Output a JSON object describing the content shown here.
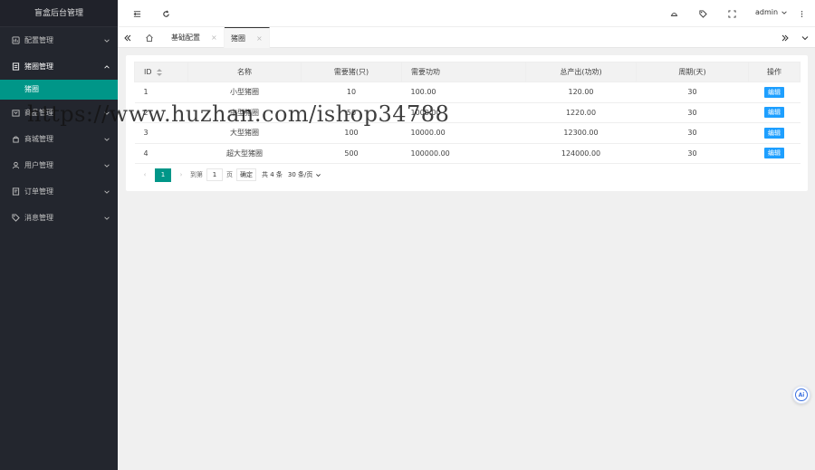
{
  "app": {
    "title": "盲盒后台管理"
  },
  "sidebar": {
    "items": [
      {
        "label": "配置管理",
        "icon": "settings-icon",
        "open": false
      },
      {
        "label": "猪圈管理",
        "icon": "document-icon",
        "open": true,
        "children": [
          {
            "label": "猪圈"
          }
        ]
      },
      {
        "label": "商品管理",
        "icon": "box-icon",
        "open": false
      },
      {
        "label": "商城管理",
        "icon": "shop-icon",
        "open": false
      },
      {
        "label": "用户管理",
        "icon": "user-icon",
        "open": false
      },
      {
        "label": "订单管理",
        "icon": "order-icon",
        "open": false
      },
      {
        "label": "消息管理",
        "icon": "tag-icon",
        "open": false
      }
    ]
  },
  "header": {
    "user": "admin"
  },
  "tabs": [
    {
      "label": "基础配置",
      "active": false
    },
    {
      "label": "猪圈",
      "active": true
    }
  ],
  "table": {
    "columns": [
      "ID",
      "名称",
      "需要猪(只)",
      "需要功劝",
      "总产出(功劝)",
      "周期(天)",
      "操作"
    ],
    "rows": [
      {
        "id": "1",
        "name": "小型猪圈",
        "pigs": "10",
        "cost": "100.00",
        "output": "120.00",
        "days": "30",
        "action": "编辑"
      },
      {
        "id": "2",
        "name": "中型猪圈",
        "pigs": "50",
        "cost": "1000.00",
        "output": "1220.00",
        "days": "30",
        "action": "编辑"
      },
      {
        "id": "3",
        "name": "大型猪圈",
        "pigs": "100",
        "cost": "10000.00",
        "output": "12300.00",
        "days": "30",
        "action": "编辑"
      },
      {
        "id": "4",
        "name": "超大型猪圈",
        "pigs": "500",
        "cost": "100000.00",
        "output": "124000.00",
        "days": "30",
        "action": "编辑"
      }
    ]
  },
  "pager": {
    "current": "1",
    "goto_label": "到第",
    "goto_value": "1",
    "page_unit": "页",
    "confirm": "确定",
    "total": "共 4 条",
    "page_size": "30 条/页"
  },
  "watermark": "https://www.huzhan.com/ishop34788",
  "ai_badge": "Ai",
  "colors": {
    "sidebar": "#23262e",
    "accent": "#009688",
    "button": "#1e9fff"
  }
}
